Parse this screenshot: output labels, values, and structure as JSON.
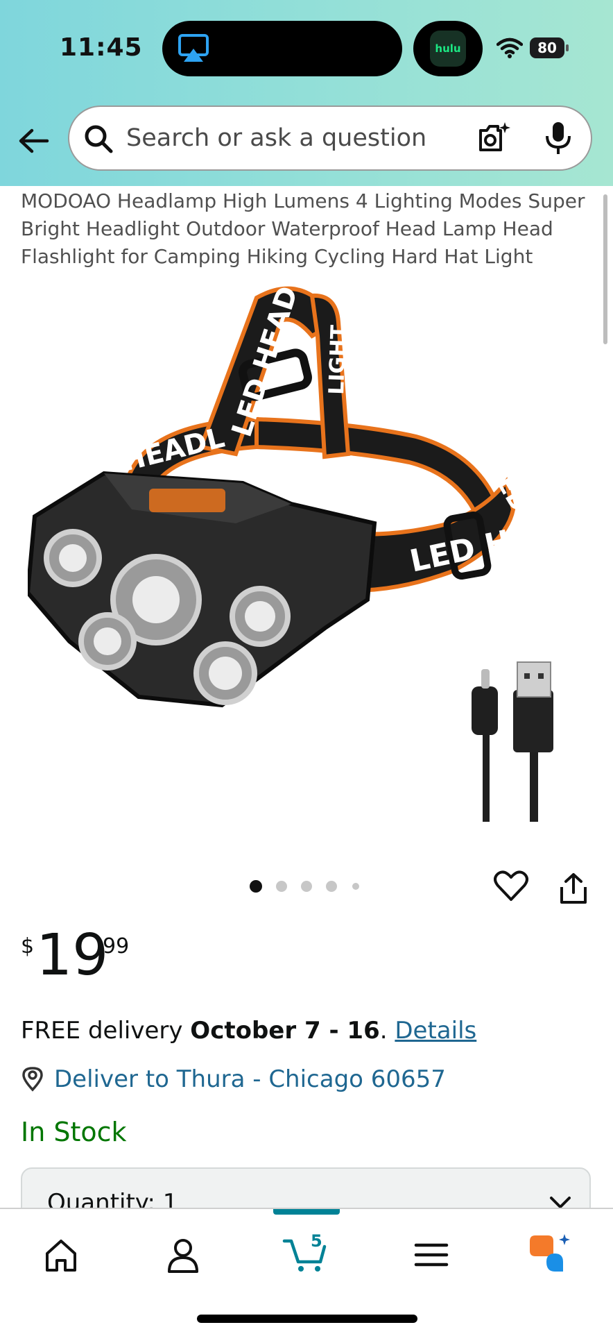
{
  "status_bar": {
    "time": "11:45",
    "app_badge": "hulu",
    "battery": "80"
  },
  "search": {
    "placeholder": "Search or ask a question"
  },
  "product": {
    "title": "MODOAO Headlamp High Lumens 4 Lighting Modes Super Bright Headlight Outdoor Waterproof Head Lamp Head Flashlight for Camping Hiking Cycling Hard Hat Light",
    "image_labels": [
      "LED HEADLIGHT",
      "LIGHT",
      "HEADL",
      "LED",
      "LED HEAD"
    ],
    "image_count": 5,
    "active_image_index": 0,
    "price": {
      "symbol": "$",
      "whole": "19",
      "fraction": "99"
    },
    "delivery": {
      "prefix": "FREE delivery ",
      "dates": "October 7 - 16",
      "separator": ". ",
      "details_link": "Details"
    },
    "deliver_to": "Deliver to Thura - Chicago 60657",
    "stock": "In Stock",
    "quantity_label": "Quantity: 1"
  },
  "tab_bar": {
    "active_tab": "cart",
    "cart_count": "5",
    "tabs": [
      "home",
      "account",
      "cart",
      "menu",
      "rufus"
    ]
  },
  "colors": {
    "header_gradient_start": "#7fd6dc",
    "header_gradient_end": "#a6e6d2",
    "link": "#1f6791",
    "in_stock": "#007600",
    "accent_teal": "#008296",
    "headband_orange": "#e8731c"
  },
  "icons": [
    "airplay-icon",
    "wifi-icon",
    "back-arrow-icon",
    "search-icon",
    "camera-icon",
    "mic-icon",
    "heart-icon",
    "share-icon",
    "location-icon",
    "chevron-down-icon",
    "home-icon",
    "account-icon",
    "cart-icon",
    "menu-icon",
    "rufus-icon"
  ]
}
